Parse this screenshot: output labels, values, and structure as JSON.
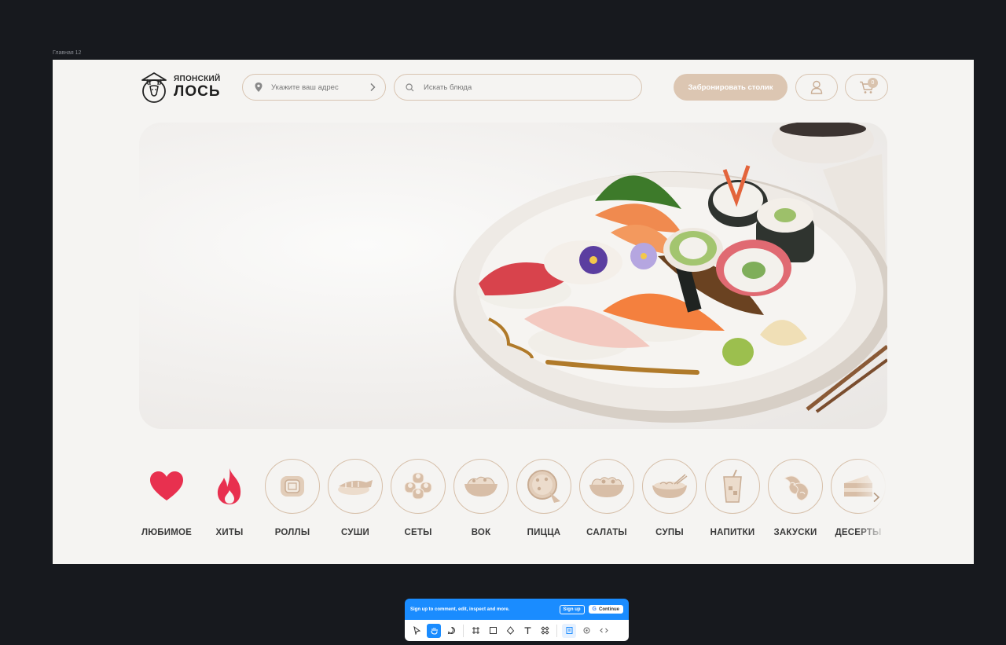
{
  "frame": {
    "label": "Главная 12"
  },
  "header": {
    "logo_top": "ЯПОНСКИЙ",
    "logo_bottom": "ЛОСЬ",
    "address_placeholder": "Укажите ваш адрес",
    "search_placeholder": "Искать блюда",
    "book_label": "Забронировать столик",
    "cart_count": "0"
  },
  "categories": [
    {
      "label": "ЛЮБИМОЕ",
      "icon": "heart-icon"
    },
    {
      "label": "ХИТЫ",
      "icon": "fire-icon"
    },
    {
      "label": "РОЛЛЫ",
      "icon": "roll-icon"
    },
    {
      "label": "СУШИ",
      "icon": "sushi-icon"
    },
    {
      "label": "СЕТЫ",
      "icon": "set-icon"
    },
    {
      "label": "ВОК",
      "icon": "wok-icon"
    },
    {
      "label": "ПИЦЦА",
      "icon": "pizza-icon"
    },
    {
      "label": "САЛАТЫ",
      "icon": "salad-icon"
    },
    {
      "label": "СУПЫ",
      "icon": "soup-icon"
    },
    {
      "label": "НАПИТКИ",
      "icon": "drink-icon"
    },
    {
      "label": "ЗАКУСКИ",
      "icon": "shrimp-icon"
    },
    {
      "label": "ДЕСЕРТЫ",
      "icon": "cake-icon"
    }
  ],
  "colors": {
    "accent": "#dcc6b2",
    "border": "#d8c4b1",
    "heart": "#e8304f",
    "toolbar": "#1a8cff"
  },
  "toolbar": {
    "signup_text": "Sign up to comment, edit, inspect and more.",
    "signup_button": "Sign up",
    "continue_button": "Continue",
    "google_letter": "G"
  }
}
